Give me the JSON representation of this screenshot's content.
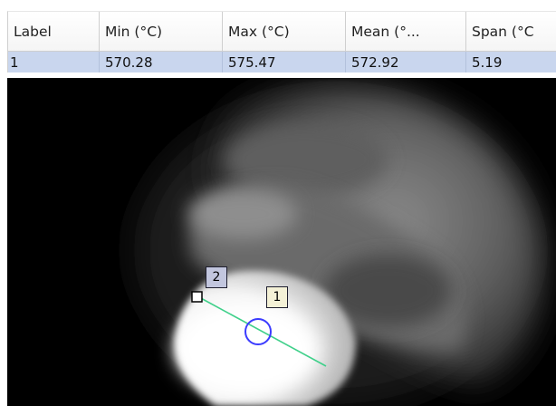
{
  "grid": {
    "columns": [
      "Label",
      "Min (°C)",
      "Max (°C)",
      "Mean (°...",
      "Span (°C"
    ],
    "rows": [
      [
        "1",
        "570.28",
        "575.47",
        "572.92",
        "5.19"
      ]
    ],
    "selected_row_color": "#c9d6ee"
  },
  "image": {
    "markers": [
      {
        "label": "2",
        "color": "#c2c6de"
      },
      {
        "label": "1",
        "color": "#f4f1d6"
      }
    ],
    "line_color": "#3fd08a",
    "circle_color": "#3b3bff"
  }
}
